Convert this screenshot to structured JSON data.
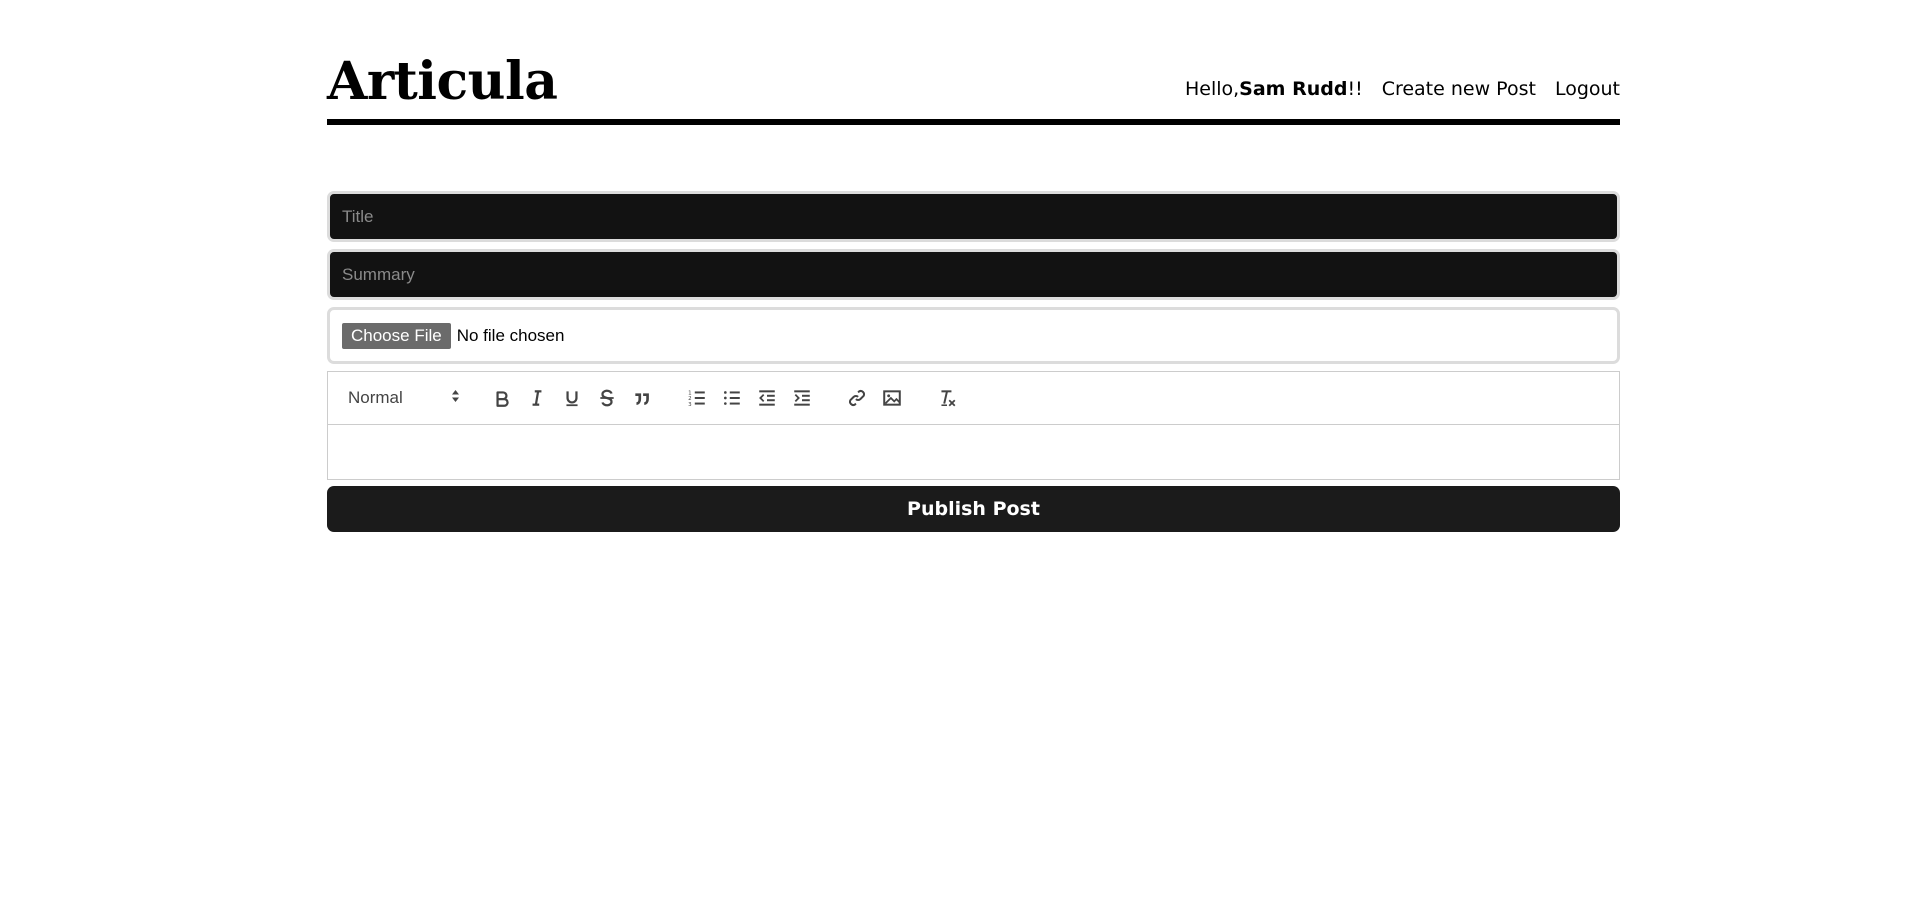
{
  "header": {
    "logo": "Articula",
    "greeting_prefix": "Hello,",
    "username": "Sam Rudd",
    "greeting_suffix": "!!",
    "create_link": "Create new Post",
    "logout_link": "Logout"
  },
  "form": {
    "title_placeholder": "Title",
    "summary_placeholder": "Summary",
    "file_button": "Choose File",
    "file_status": "No file chosen",
    "publish_label": "Publish Post"
  },
  "editor": {
    "header_select": "Normal",
    "toolbar": [
      "bold-icon",
      "italic-icon",
      "underline-icon",
      "strikethrough-icon",
      "quote-icon",
      "ordered-list-icon",
      "bullet-list-icon",
      "outdent-icon",
      "indent-icon",
      "link-icon",
      "image-icon",
      "clear-format-icon"
    ]
  },
  "colors": {
    "input_bg": "#121212",
    "button_bg": "#1b1b1b",
    "file_button_bg": "#6b6b6b",
    "border": "#dcdcdc"
  }
}
